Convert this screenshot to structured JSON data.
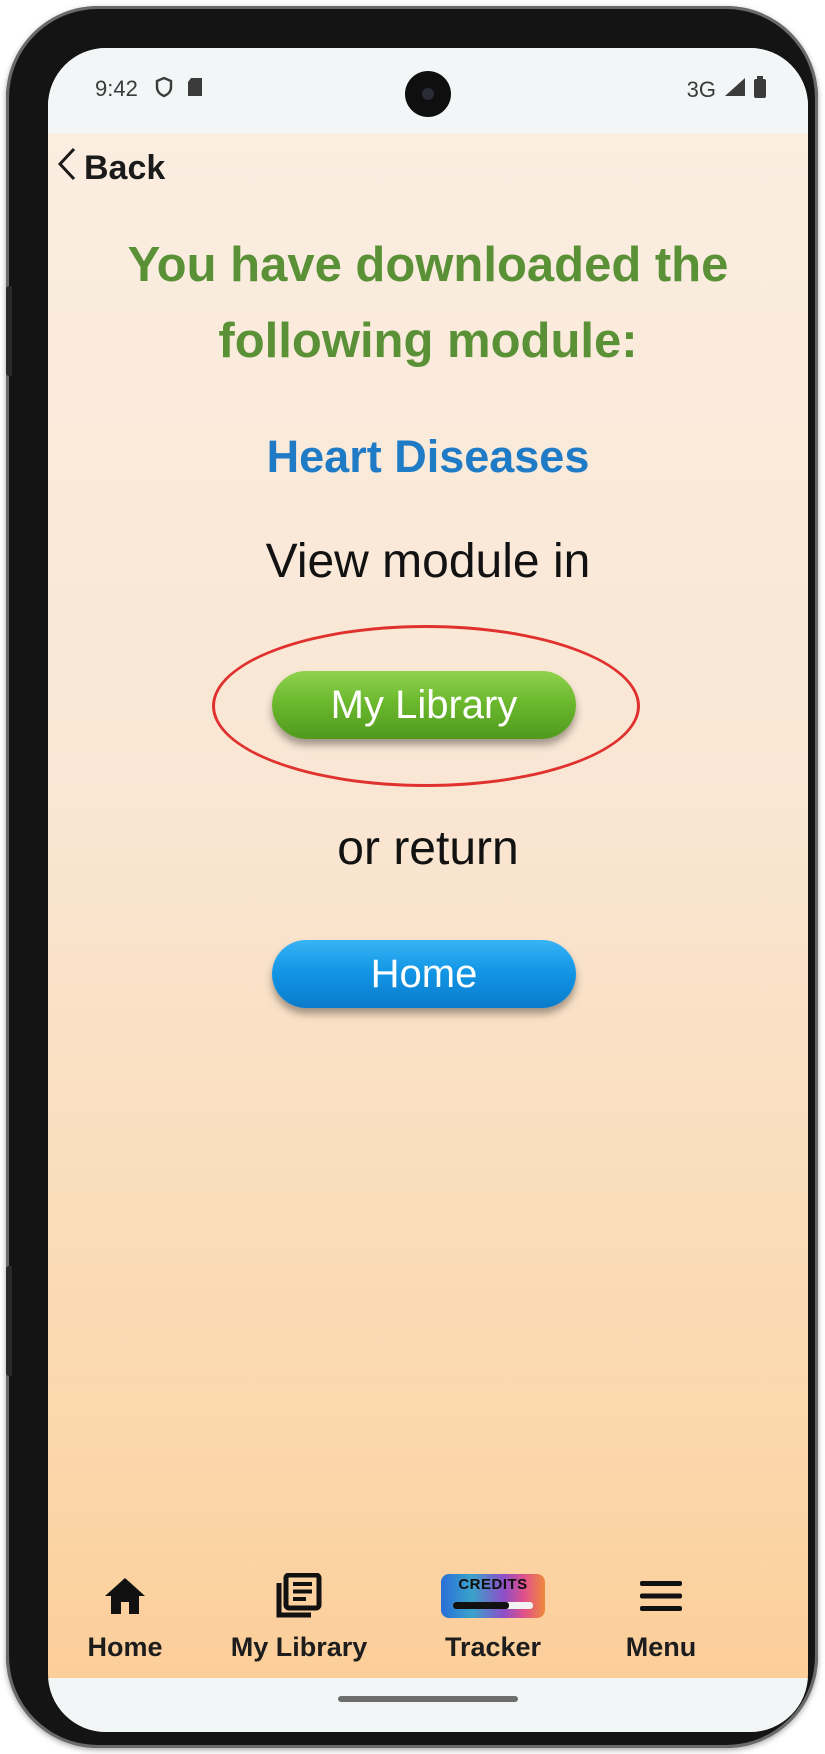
{
  "status_bar": {
    "time": "9:42",
    "left_icons": [
      "shield-icon",
      "sd-card-icon"
    ],
    "network": "3G",
    "right_icons": [
      "signal-icon",
      "battery-icon"
    ]
  },
  "header": {
    "back_label": "Back"
  },
  "main": {
    "headline": "You have downloaded the following module:",
    "module_name": "Heart Diseases",
    "view_prompt": "View module in",
    "library_button_label": "My Library",
    "return_prompt": "or return",
    "home_button_label": "Home"
  },
  "annotation": {
    "highlight_color": "#e0312f"
  },
  "bottom_nav": {
    "items": [
      {
        "label": "Home",
        "icon": "home-icon"
      },
      {
        "label": "My Library",
        "icon": "library-icon"
      },
      {
        "label": "Tracker",
        "icon": "credits-tracker-icon",
        "badge_text": "CREDITS",
        "progress": 0.7
      },
      {
        "label": "Menu",
        "icon": "menu-icon"
      }
    ]
  },
  "colors": {
    "headline": "#5a9137",
    "module_name": "#1f7bc6",
    "library_button": "#6cb92e",
    "home_button": "#1397e6",
    "background_top": "#fbeee2",
    "background_bottom": "#fccc95"
  }
}
